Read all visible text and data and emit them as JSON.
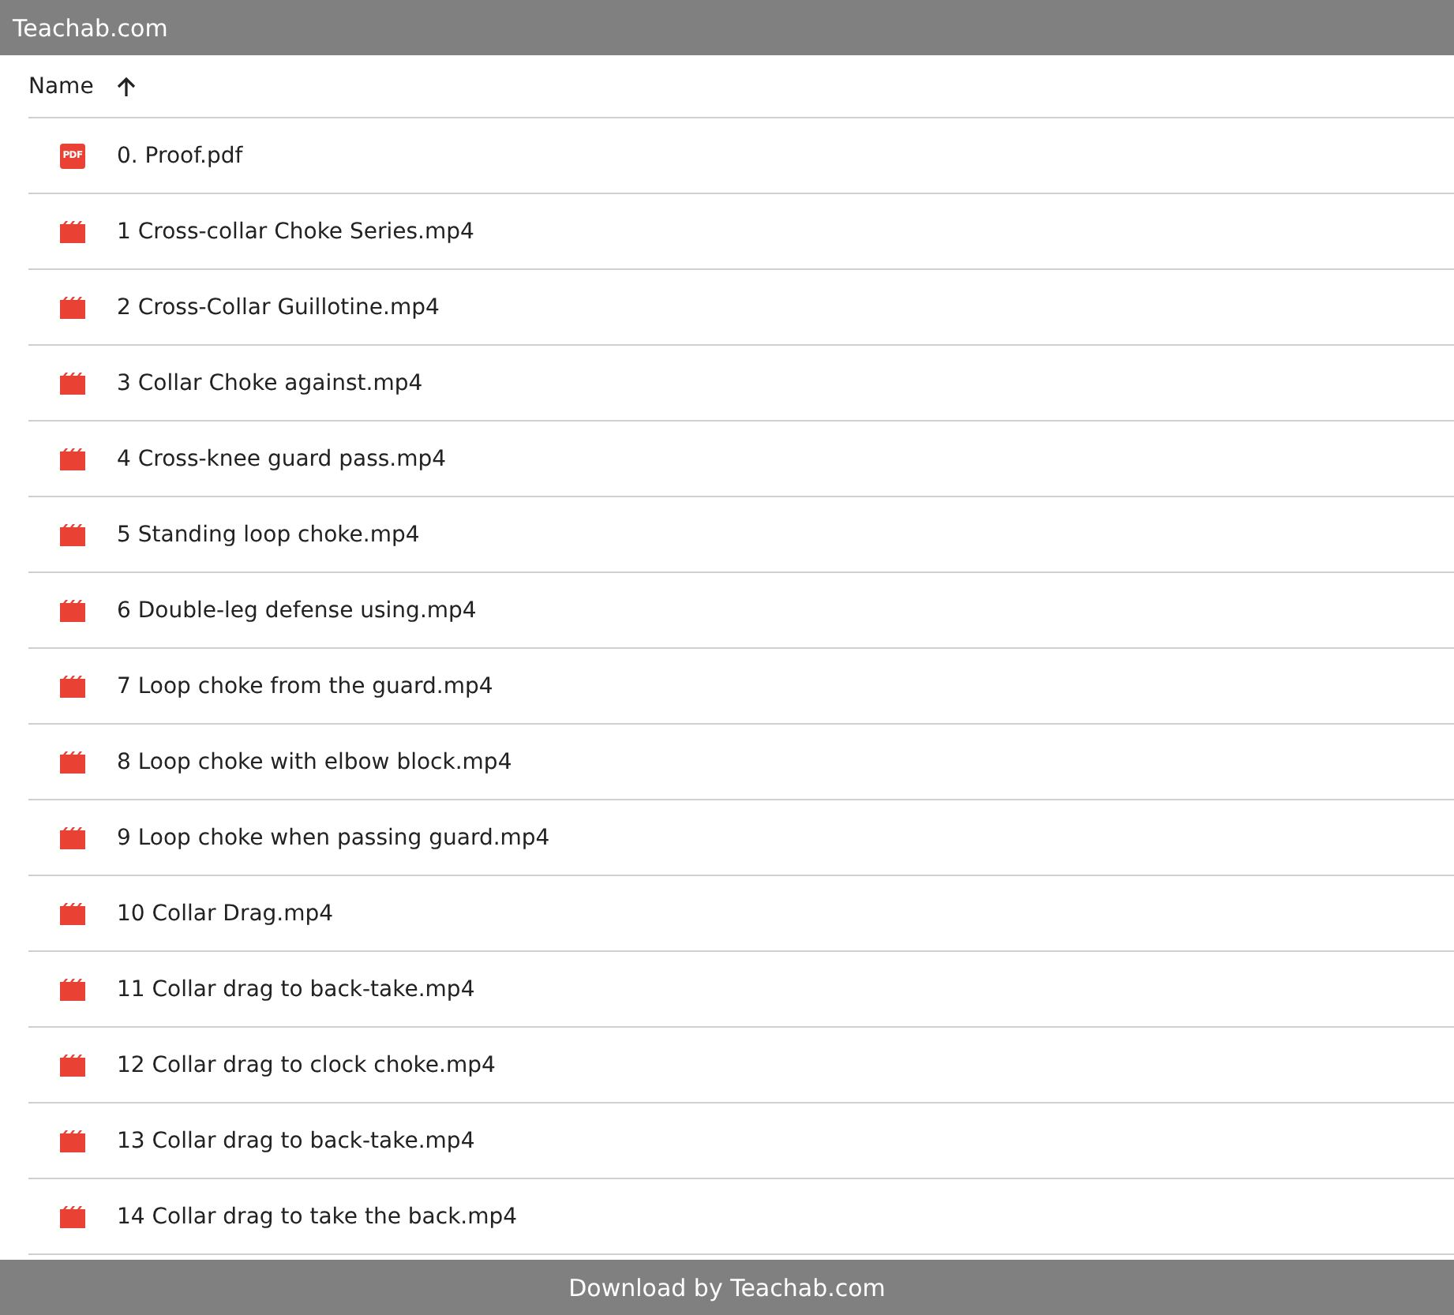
{
  "header": {
    "title": "Teachab.com"
  },
  "table": {
    "columns": [
      {
        "label": "Name",
        "sort_ascending": true
      }
    ],
    "rows": [
      {
        "name": "0. Proof.pdf",
        "kind": "pdf",
        "icon_label": "PDF"
      },
      {
        "name": "1 Cross-collar Choke Series.mp4",
        "kind": "video"
      },
      {
        "name": "2 Cross-Collar Guillotine.mp4",
        "kind": "video"
      },
      {
        "name": "3 Collar Choke against.mp4",
        "kind": "video"
      },
      {
        "name": "4 Cross-knee guard pass.mp4",
        "kind": "video"
      },
      {
        "name": "5 Standing loop choke.mp4",
        "kind": "video"
      },
      {
        "name": "6 Double-leg defense using.mp4",
        "kind": "video"
      },
      {
        "name": "7 Loop choke from the guard.mp4",
        "kind": "video"
      },
      {
        "name": "8 Loop choke with elbow block.mp4",
        "kind": "video"
      },
      {
        "name": "9 Loop choke when passing guard.mp4",
        "kind": "video"
      },
      {
        "name": "10 Collar Drag.mp4",
        "kind": "video"
      },
      {
        "name": "11 Collar drag to back-take.mp4",
        "kind": "video"
      },
      {
        "name": "12 Collar drag to clock choke.mp4",
        "kind": "video"
      },
      {
        "name": "13 Collar drag to back-take.mp4",
        "kind": "video"
      },
      {
        "name": "14 Collar drag to take the back.mp4",
        "kind": "video"
      }
    ]
  },
  "footer": {
    "text": "Download by Teachab.com"
  }
}
